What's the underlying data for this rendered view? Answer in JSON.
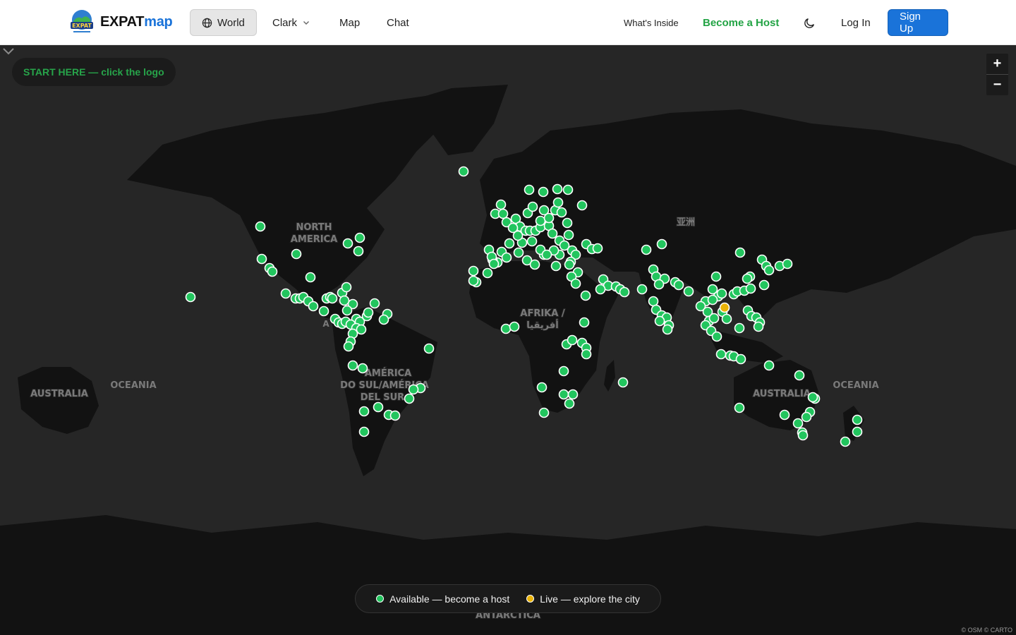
{
  "header": {
    "logo_text": "EXPAT",
    "logo_accent": "map",
    "logo_badge_text": "EXPAT",
    "nav_world": "World",
    "nav_clark": "Clark",
    "nav_map": "Map",
    "nav_chat": "Chat",
    "nav_inside": "What's Inside",
    "nav_host": "Become a Host",
    "nav_login": "Log In",
    "nav_signup": "Sign Up"
  },
  "map": {
    "start_hint": "START HERE — click the logo",
    "zoom_in": "+",
    "zoom_out": "−",
    "attribution": "© OSM © CARTO",
    "labels": {
      "north_america_1": "NORTH",
      "north_america_2": "AMERICA",
      "asia": "亚洲",
      "africa_1": "AFRIKA /",
      "africa_2": "أفريقيا",
      "south_america_1": "AMÉRICA",
      "south_america_2": "DO SUL/AMÉRICA",
      "south_america_3": "DEL SUR",
      "australia_left": "AUSTRALIA",
      "oceania_left": "OCEANIA",
      "australia_right": "AUSTRALIA",
      "oceania_right": "OCEANIA",
      "antarctica": "ANTARCTICA",
      "america_fragment": "A"
    },
    "colors": {
      "available": "#22c55e",
      "live": "#eab308",
      "land": "#121212",
      "water": "#262626"
    }
  },
  "legend": {
    "available": "Available — become a host",
    "live": "Live — explore the city"
  }
}
